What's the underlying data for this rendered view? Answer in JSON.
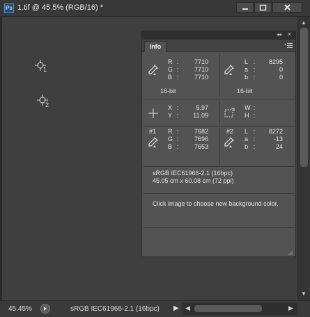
{
  "window": {
    "title": "1.tif @ 45.5% (RGB/16) *",
    "app_icon": "Ps"
  },
  "canvas": {
    "samplers": [
      {
        "number": "1"
      },
      {
        "number": "2"
      }
    ]
  },
  "info_panel": {
    "tab_label": "Info",
    "rgb_readout": {
      "labels": [
        "R",
        "G",
        "B"
      ],
      "values": [
        "7710",
        "7710",
        "7710"
      ],
      "bit_depth": "16-bit"
    },
    "lab_readout": {
      "labels": [
        "L",
        "a",
        "b"
      ],
      "values": [
        "8295",
        "0",
        "0"
      ],
      "bit_depth": "16-bit"
    },
    "position": {
      "labels": [
        "X",
        "Y"
      ],
      "values": [
        "5.97",
        "11.09"
      ]
    },
    "size": {
      "labels": [
        "W",
        "H"
      ],
      "values": [
        "",
        ""
      ]
    },
    "sampler1": {
      "tag": "#1",
      "labels": [
        "R",
        "G",
        "B"
      ],
      "values": [
        "7682",
        "7696",
        "7653"
      ]
    },
    "sampler2": {
      "tag": "#2",
      "labels": [
        "L",
        "a",
        "b"
      ],
      "values": [
        "8272",
        "-13",
        "24"
      ]
    },
    "doc_profile": "sRGB IEC61966-2.1 (16bpc)",
    "doc_size": "45.05 cm x 60.08 cm (72 ppi)",
    "hint": "Click image to choose new background color."
  },
  "status": {
    "zoom": "45.45%",
    "profile": "sRGB IEC61966-2.1 (16bpc)"
  },
  "colors": {
    "canvas_bg": "#3f3f3f",
    "panel_bg": "#535353",
    "chrome_bg": "#383838"
  }
}
